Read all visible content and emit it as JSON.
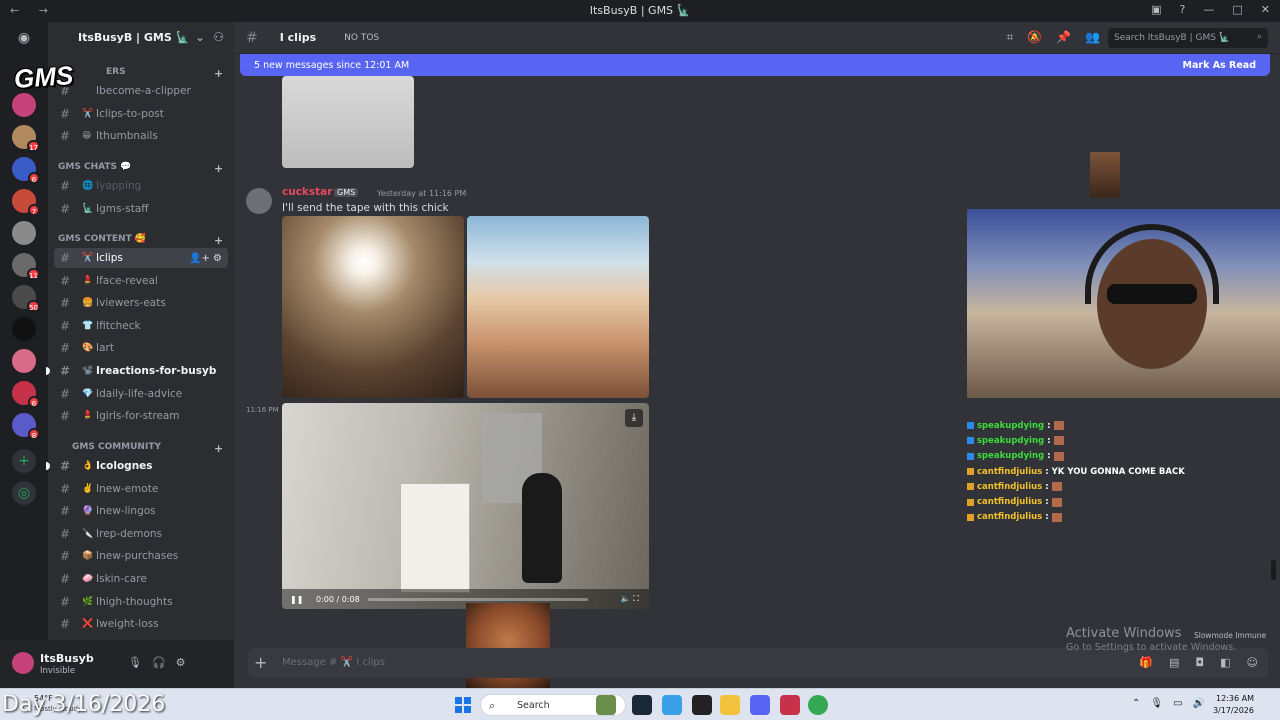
{
  "window": {
    "title": "ItsBusyB | GMS 🗽"
  },
  "server": {
    "name": "ItsBusyB | GMS 🗽",
    "logo_text": "GMS"
  },
  "rail_badges": [
    "",
    "17",
    "6",
    "7",
    "",
    "11",
    "50",
    "",
    "",
    "6",
    "8"
  ],
  "sidebar": {
    "cat_clippers": "ERS",
    "cat_chats": "GMS CHATS 💬",
    "cat_content": "GMS CONTENT 🥰",
    "cat_community": "GMS COMMUNITY",
    "channels_top": [
      {
        "emo": "",
        "label": "become-a-clipper"
      },
      {
        "emo": "✂️",
        "label": "clips-to-post"
      },
      {
        "emo": "😁",
        "label": "thumbnails"
      }
    ],
    "channels_chats": [
      {
        "emo": "🌐",
        "label": "yapping"
      },
      {
        "emo": "🗽",
        "label": "gms-staff"
      }
    ],
    "channels_content": [
      {
        "emo": "✂️",
        "label": "clips"
      },
      {
        "emo": "💄",
        "label": "face-reveal"
      },
      {
        "emo": "🍔",
        "label": "viewers-eats"
      },
      {
        "emo": "👕",
        "label": "fitcheck"
      },
      {
        "emo": "🎨",
        "label": "art"
      },
      {
        "emo": "📽️",
        "label": "reactions-for-busyb"
      },
      {
        "emo": "💎",
        "label": "daily-life-advice"
      },
      {
        "emo": "💄",
        "label": "girls-for-stream"
      }
    ],
    "channels_community": [
      {
        "emo": "👌",
        "label": "colognes"
      },
      {
        "emo": "✌️",
        "label": "new-emote"
      },
      {
        "emo": "🔮",
        "label": "new-lingos"
      },
      {
        "emo": "🔪",
        "label": "rep-demons"
      },
      {
        "emo": "📦",
        "label": "new-purchases"
      },
      {
        "emo": "🧼",
        "label": "skin-care"
      },
      {
        "emo": "🌿",
        "label": "high-thoughts"
      },
      {
        "emo": "❌",
        "label": "weight-loss"
      }
    ]
  },
  "user": {
    "name": "ItsBusyb",
    "status": "Invisible"
  },
  "header": {
    "channel": "I clips",
    "topic": "NO TOS",
    "search_placeholder": "Search ItsBusyB | GMS 🗽"
  },
  "newbar": {
    "text": "5 new messages since 12:01 AM",
    "action": "Mark As Read"
  },
  "message": {
    "author": "cuckstar",
    "tag": "GMS",
    "timestamp": "Yesterday at 11:16 PM",
    "text": "I'll send the tape with this chick",
    "video_stamp": "11:16 PM",
    "video_time": "0:00 / 0:08",
    "video_progress": 0
  },
  "composer": {
    "placeholder": "Message # ✂️ I clips"
  },
  "stream_chat": [
    {
      "user": "speakupdying",
      "badge": "b",
      "msg": "",
      "emote": true,
      "color": "n1"
    },
    {
      "user": "speakupdying",
      "badge": "b",
      "msg": "",
      "emote": true,
      "color": "n1"
    },
    {
      "user": "speakupdying",
      "badge": "b",
      "msg": "",
      "emote": true,
      "color": "n1"
    },
    {
      "user": "cantfindjulius",
      "badge": "y",
      "msg": "YK YOU GONNA COME BACK",
      "emote": false,
      "color": "n2"
    },
    {
      "user": "cantfindjulius",
      "badge": "y",
      "msg": "",
      "emote": true,
      "color": "n2"
    },
    {
      "user": "cantfindjulius",
      "badge": "y",
      "msg": "",
      "emote": true,
      "color": "n2"
    },
    {
      "user": "cantfindjulius",
      "badge": "y",
      "msg": "",
      "emote": true,
      "color": "n2"
    }
  ],
  "watermark": {
    "line1": "Activate Windows",
    "line2": "Go to Settings to activate Windows."
  },
  "slowmode": "Slowmode Immune",
  "taskbar": {
    "weather_temp": "54°F",
    "weather_desc": "Mostly cloudy",
    "search": "Search",
    "time": "12:36 AM",
    "date": "3/17/2026"
  },
  "overlay_date": "Day 3/16/2026",
  "colors": {
    "accent": "#5865f2",
    "author": "#e8485d",
    "chat_green": "#3bdc3b",
    "chat_gold": "#f2c02a"
  },
  "icons": [
    "discord-icon",
    "add-friend-icon",
    "threads-icon",
    "mute-icon",
    "pin-icon",
    "members-icon",
    "search-icon",
    "mic-icon",
    "headphones-icon",
    "settings-icon",
    "download-icon",
    "play-pause-icon",
    "fullscreen-icon",
    "windows-icon"
  ]
}
